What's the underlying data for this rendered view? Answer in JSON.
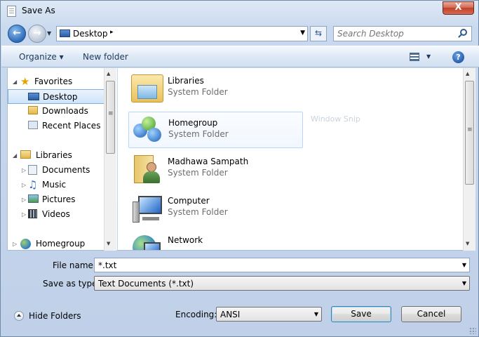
{
  "window": {
    "title": "Save As",
    "close_label": "X"
  },
  "address": {
    "path": "Desktop",
    "separator": "▸",
    "search_placeholder": "Search Desktop"
  },
  "toolbar": {
    "organize": "Organize ▾",
    "new_folder": "New folder",
    "view_drop": "▼",
    "help": "?"
  },
  "nav": {
    "favorites": "Favorites",
    "desktop": "Desktop",
    "downloads": "Downloads",
    "recent_places": "Recent Places",
    "libraries": "Libraries",
    "documents": "Documents",
    "music": "Music",
    "pictures": "Pictures",
    "videos": "Videos",
    "homegroup": "Homegroup"
  },
  "items": [
    {
      "name": "Libraries",
      "sub": "System Folder"
    },
    {
      "name": "Homegroup",
      "sub": "System Folder"
    },
    {
      "name": "Madhawa Sampath",
      "sub": "System Folder"
    },
    {
      "name": "Computer",
      "sub": "System Folder"
    },
    {
      "name": "Network",
      "sub": ""
    }
  ],
  "ghost_text": "Window Snip",
  "form": {
    "file_name_label": "File name:",
    "file_name_value": "*.txt",
    "save_type_label": "Save as type:",
    "save_type_value": "Text Documents (*.txt)",
    "encoding_label": "Encoding:",
    "encoding_value": "ANSI"
  },
  "buttons": {
    "hide_folders": "Hide Folders",
    "save": "Save",
    "cancel": "Cancel"
  },
  "colors": {
    "accent": "#2e6cb8",
    "close": "#c0402a",
    "selected": "#cfe4f9"
  }
}
